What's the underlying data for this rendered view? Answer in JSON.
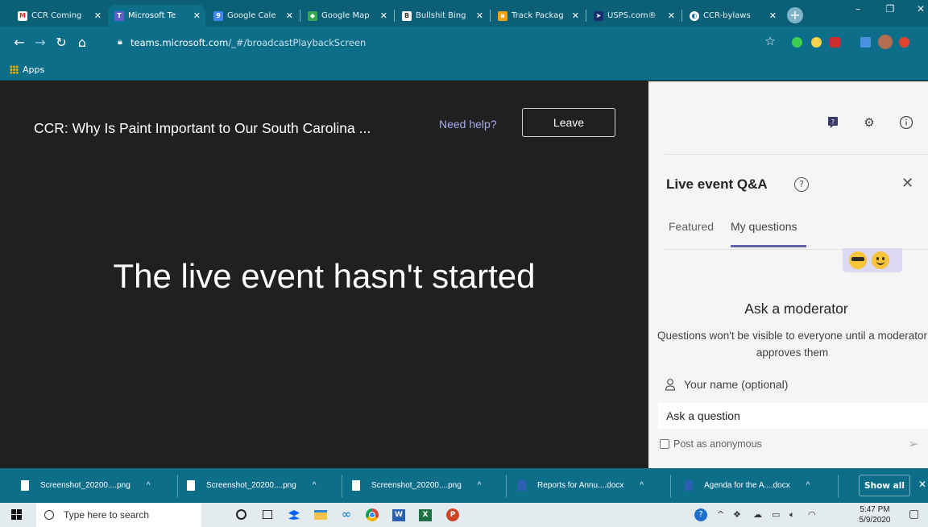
{
  "browser": {
    "tabs": [
      {
        "title": "CCR Coming",
        "icon": "gmail-icon"
      },
      {
        "title": "Microsoft Te",
        "icon": "teams-icon"
      },
      {
        "title": "Google Cale",
        "icon": "calendar-icon"
      },
      {
        "title": "Google Map",
        "icon": "maps-icon"
      },
      {
        "title": "Bullshit Bing",
        "icon": "bingo-icon"
      },
      {
        "title": "Track Packag",
        "icon": "amazon-icon"
      },
      {
        "title": "USPS.com®",
        "icon": "usps-icon"
      },
      {
        "title": "CCR-bylaws",
        "icon": "globe-icon"
      }
    ],
    "url_host": "teams.microsoft.com",
    "url_path": "/_#/broadcastPlaybackScreen",
    "bookmarks_label": "Apps"
  },
  "event": {
    "title": "CCR: Why Is Paint Important to Our South Carolina ...",
    "help_link": "Need help?",
    "leave_label": "Leave",
    "status_message": "The live event hasn't started"
  },
  "qa": {
    "title": "Live event Q&A",
    "tabs": [
      {
        "label": "Featured",
        "selected": false
      },
      {
        "label": "My questions",
        "selected": true
      }
    ],
    "moderator_title": "Ask a moderator",
    "moderator_desc": "Questions won't be visible to everyone until a moderator approves them",
    "name_placeholder": "Your name (optional)",
    "question_placeholder": "Ask a question",
    "anonymous_label": "Post as anonymous"
  },
  "downloads": {
    "items": [
      {
        "name": "Screenshot_20200....png",
        "type": "image"
      },
      {
        "name": "Screenshot_20200....png",
        "type": "image"
      },
      {
        "name": "Screenshot_20200....png",
        "type": "image"
      },
      {
        "name": "Reports for Annu....docx",
        "type": "word"
      },
      {
        "name": "Agenda for the A....docx",
        "type": "word"
      }
    ],
    "show_all_label": "Show all"
  },
  "taskbar": {
    "search_placeholder": "Type here to search",
    "time": "5:47 PM",
    "date": "5/9/2020"
  },
  "colors": {
    "chrome_theme": "#0d6e8a",
    "stage_bg": "#202020",
    "panel_bg": "#f5f5f5",
    "teams_accent": "#6264a7"
  }
}
